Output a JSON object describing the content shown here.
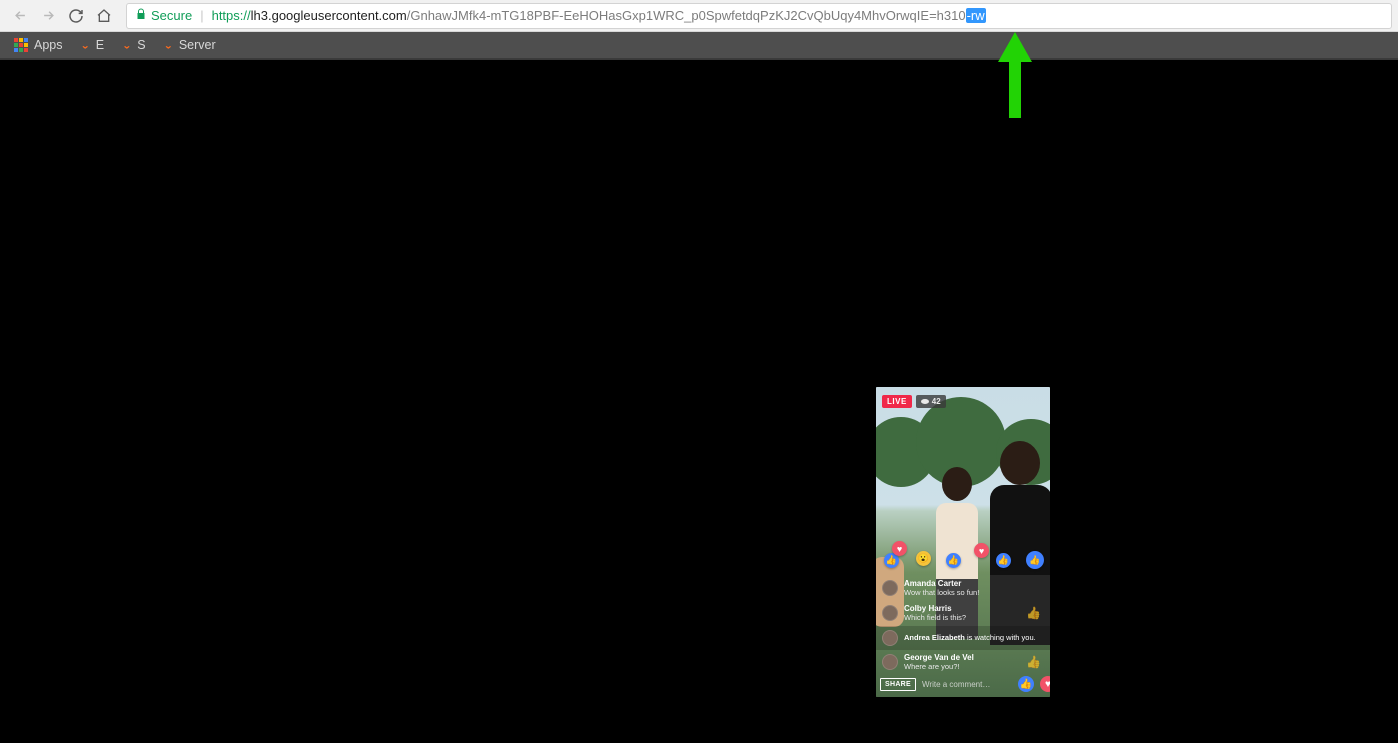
{
  "chrome": {
    "secure_label": "Secure",
    "url_scheme": "https://",
    "url_host": "lh3.googleusercontent.com",
    "url_path": "/GnhawJMfk4-mTG18PBF-EeHOHasGxp1WRC_p0SpwfetdqPzKJ2CvQbUqy4MhvOrwqIE=h310",
    "url_selected": "-rw"
  },
  "bookmarks": {
    "apps": "Apps",
    "items": [
      {
        "label": "E"
      },
      {
        "label": "S"
      },
      {
        "label": "Server"
      }
    ]
  },
  "live": {
    "live_label": "LIVE",
    "viewer_count": "42",
    "share_label": "SHARE",
    "compose_placeholder": "Write a comment…",
    "comments": [
      {
        "name": "Amanda Carter",
        "msg": "Wow that looks so fun!"
      },
      {
        "name": "Colby Harris",
        "msg": "Which field is this?"
      }
    ],
    "system": {
      "who": "Andrea Elizabeth",
      "rest": " is watching with you."
    },
    "comments2": [
      {
        "name": "George Van de Vel",
        "msg": "Where are you?!"
      }
    ]
  }
}
